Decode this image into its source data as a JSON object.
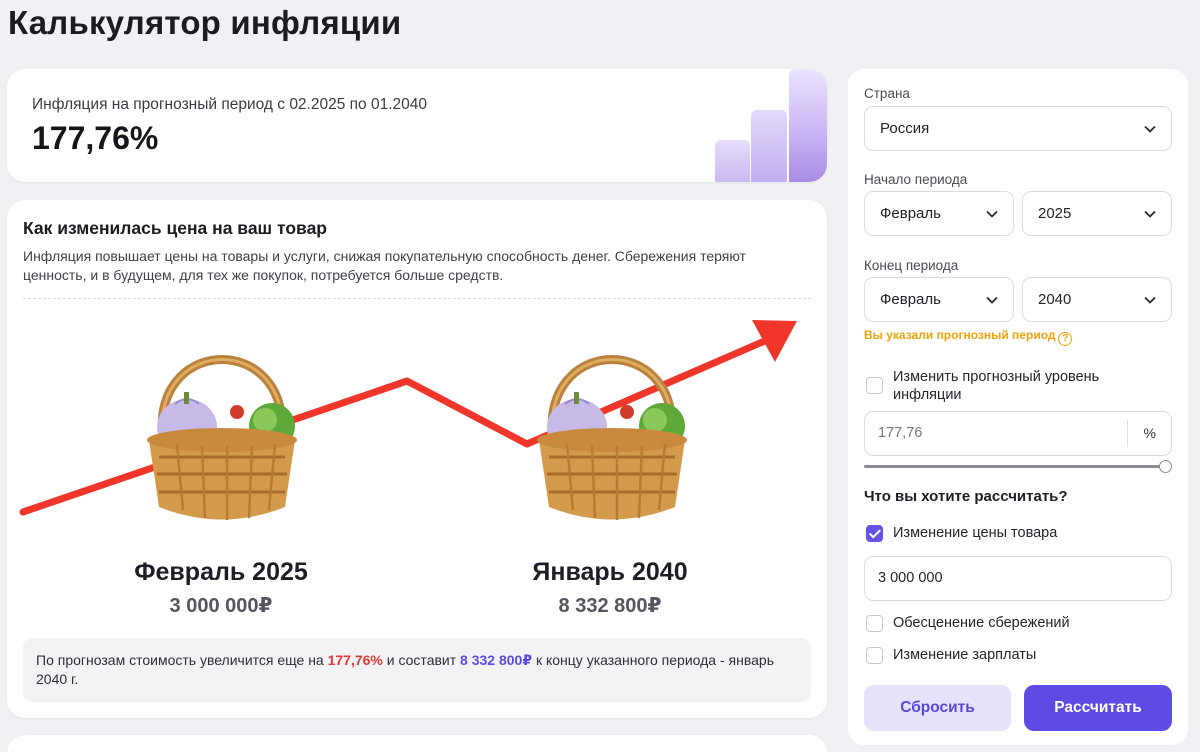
{
  "page": {
    "title": "Калькулятор инфляции"
  },
  "inflation_summary": {
    "label": "Инфляция на прогнозный период с 02.2025 по 01.2040",
    "value": "177,76%"
  },
  "product_card": {
    "title": "Как изменилась цена на ваш товар",
    "description": "Инфляция повышает цены на товары и услуги, снижая покупательную способность денег. Сбережения теряют ценность, и в будущем, для тех же покупок, потребуется больше средств.",
    "start": {
      "label": "Февраль 2025",
      "value": "3 000 000₽"
    },
    "end": {
      "label": "Январь 2040",
      "value": "8 332 800₽"
    },
    "summary": {
      "prefix": "По прогнозам стоимость увеличится еще на ",
      "percent": "177,76%",
      "middle": " и составит ",
      "amount": "8 332 800₽",
      "suffix": " к концу указанного периода - январь 2040 г."
    }
  },
  "form": {
    "country": {
      "label": "Страна",
      "value": "Россия"
    },
    "period_start": {
      "label": "Начало периода",
      "month": "Февраль",
      "year": "2025"
    },
    "period_end": {
      "label": "Конец периода",
      "month": "Февраль",
      "year": "2040"
    },
    "forecast_warning": "Вы указали прогнозный период",
    "warning_icon": "?",
    "change_inflation": {
      "label": "Изменить прогнозный уровень инфляции",
      "checked": false
    },
    "inflation_input": {
      "value": "177,76",
      "unit": "%"
    },
    "inflation_slider_fraction": 1.0,
    "question": "Что вы хотите рассчитать?",
    "options": [
      {
        "label": "Изменение цены товара",
        "checked": true
      },
      {
        "label": "Обесценение сбережений",
        "checked": false
      },
      {
        "label": "Изменение зарплаты",
        "checked": false
      }
    ],
    "price_input": {
      "value": "3 000 000"
    },
    "reset_button": "Сбросить",
    "calculate_button": "Рассчитать"
  },
  "colors": {
    "accent": "#5e4be3",
    "warning": "#f0a20b",
    "highlight_red": "#e53935",
    "arrow": "#f0362a"
  }
}
